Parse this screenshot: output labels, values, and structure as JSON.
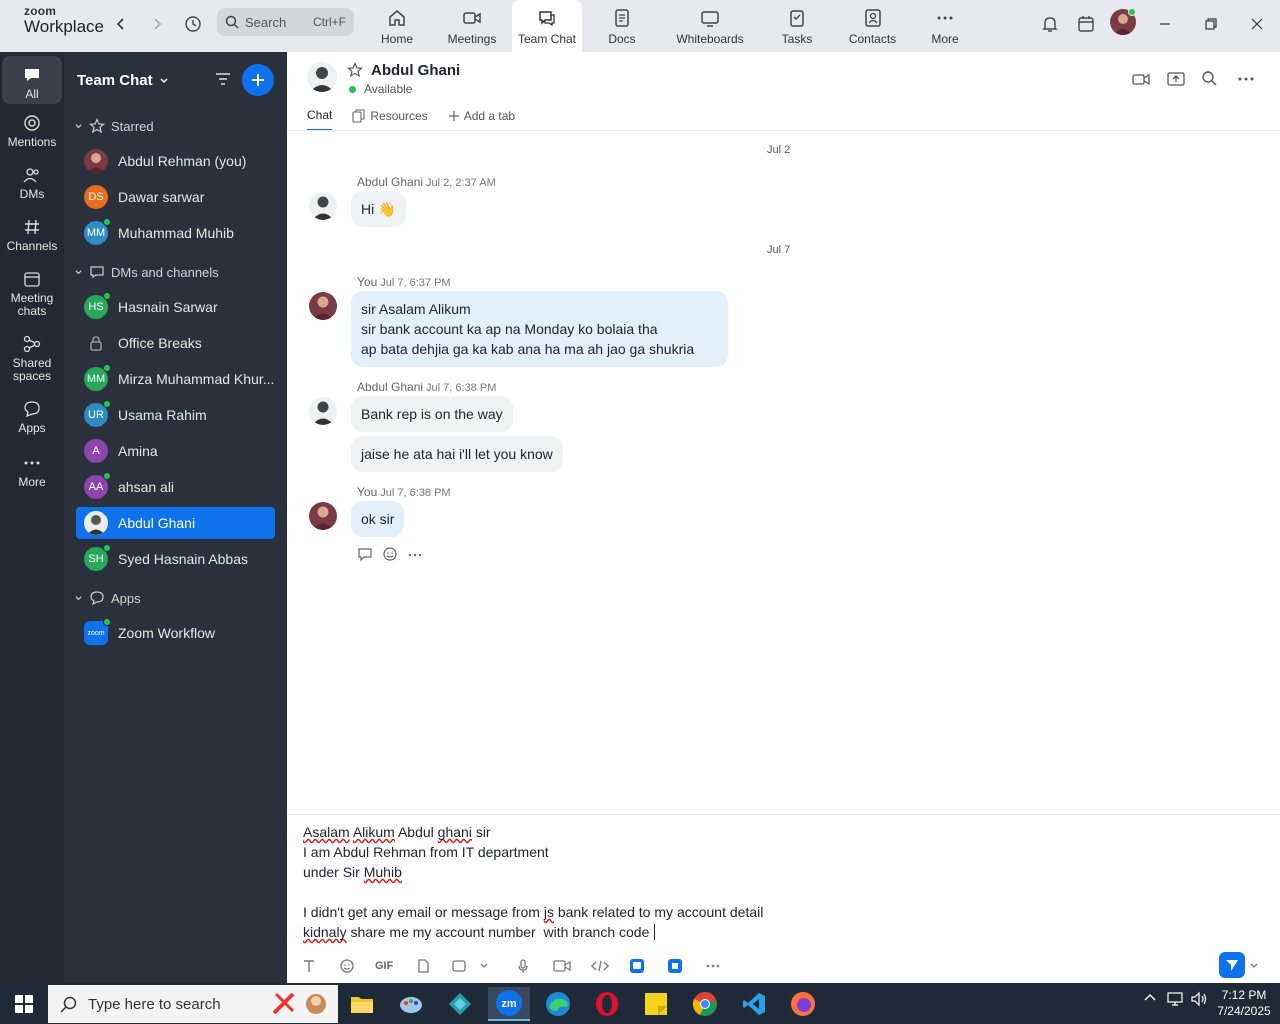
{
  "brand": {
    "line1": "zoom",
    "line2": "Workplace"
  },
  "search": {
    "label": "Search",
    "shortcut": "Ctrl+F"
  },
  "nav_tabs": [
    {
      "label": "Home",
      "icon": "home-icon"
    },
    {
      "label": "Meetings",
      "icon": "video-icon"
    },
    {
      "label": "Team Chat",
      "icon": "chat-icon",
      "active": true
    },
    {
      "label": "Docs",
      "icon": "doc-icon"
    },
    {
      "label": "Whiteboards",
      "icon": "whiteboard-icon"
    },
    {
      "label": "Tasks",
      "icon": "tasks-icon"
    },
    {
      "label": "Contacts",
      "icon": "contacts-icon"
    },
    {
      "label": "More",
      "icon": "more-icon"
    }
  ],
  "rail": [
    {
      "label": "All",
      "active": true
    },
    {
      "label": "Mentions"
    },
    {
      "label": "DMs"
    },
    {
      "label": "Channels"
    },
    {
      "label": "Meeting chats"
    },
    {
      "label": "Shared spaces"
    },
    {
      "label": "Apps"
    },
    {
      "label": "More"
    }
  ],
  "sidebar": {
    "title": "Team Chat",
    "sections": {
      "starred": "Starred",
      "dms": "DMs and channels",
      "apps": "Apps"
    },
    "starred": [
      {
        "name": "Abdul Rehman (you)",
        "initials": "",
        "color": "#7a3b45"
      },
      {
        "name": "Dawar sarwar",
        "initials": "DS",
        "color": "#e86d1f"
      },
      {
        "name": "Muhammad Muhib",
        "initials": "MM",
        "color": "#2d8cc2"
      }
    ],
    "dms": [
      {
        "name": "Hasnain Sarwar",
        "initials": "HS",
        "color": "#27a85b"
      },
      {
        "name": "Office Breaks",
        "initials": "",
        "color": ""
      },
      {
        "name": "Mirza Muhammad Khur...",
        "initials": "MM",
        "color": "#27a85b"
      },
      {
        "name": "Usama Rahim",
        "initials": "UR",
        "color": "#2d8cc2"
      },
      {
        "name": "Amina",
        "initials": "A",
        "color": "#8e44ad"
      },
      {
        "name": "ahsan ali",
        "initials": "AA",
        "color": "#8e44ad"
      },
      {
        "name": "Abdul Ghani",
        "initials": "",
        "color": "#c8cbd0",
        "active": true
      },
      {
        "name": "Syed Hasnain Abbas",
        "initials": "SH",
        "color": "#27a85b"
      }
    ],
    "apps": [
      {
        "name": "Zoom Workflow",
        "initials": "zoom",
        "color": "#0e72ed"
      }
    ]
  },
  "chat": {
    "contact": "Abdul Ghani",
    "status": "Available",
    "tabs": [
      "Chat",
      "Resources",
      "Add a tab"
    ],
    "dates": [
      "Jul 2",
      "Jul 7"
    ],
    "messages": [
      {
        "sender": "Abdul Ghani",
        "time": "Jul 2, 2:37 AM",
        "text": "Hi 👋"
      },
      {
        "sender": "You",
        "time": "Jul 7, 6:37 PM",
        "lines": [
          "sir Asalam Alikum",
          "sir bank account ka ap na Monday ko bolaia tha",
          "ap bata dehjia ga ka kab ana ha ma ah jao ga shukria"
        ]
      },
      {
        "sender": "Abdul Ghani",
        "time": "Jul 7, 6:38 PM",
        "text": "Bank rep is on the way",
        "text2": "jaise he ata hai i'll let you know"
      },
      {
        "sender": "You",
        "time": "Jul 7, 6:38 PM",
        "text": "ok sir"
      }
    ]
  },
  "composer": {
    "lines": [
      "Asalam Alikum Abdul ghani sir",
      "I am Abdul Rehman from IT department",
      "under Sir Muhib",
      "",
      "I didn't get any email or message from js bank related to my account detail",
      "kidnaly share me my account number  with branch code "
    ],
    "gif_label": "GIF"
  },
  "taskbar": {
    "search_placeholder": "Type here to search",
    "time": "7:12 PM",
    "date": "7/24/2025"
  }
}
